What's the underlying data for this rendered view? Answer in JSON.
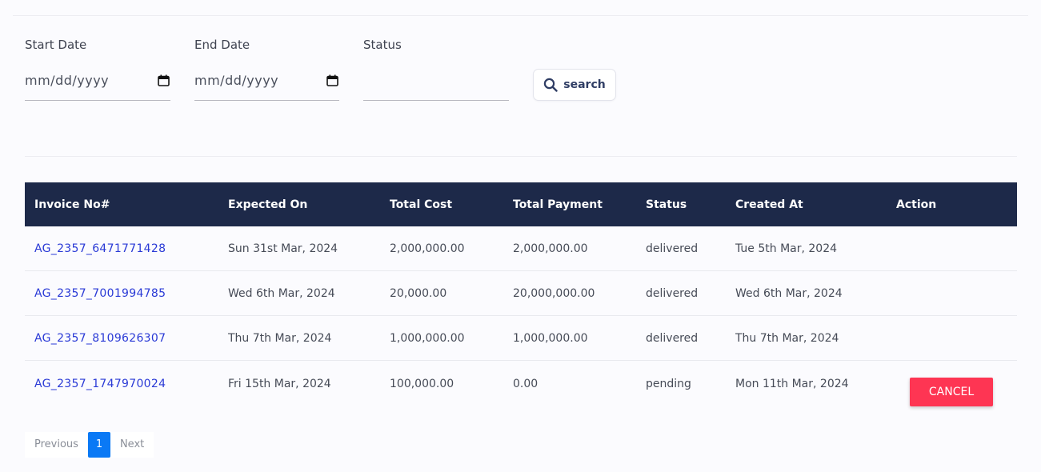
{
  "filters": {
    "start_date": {
      "label": "Start Date",
      "value": "mm/dd/yyyy"
    },
    "end_date": {
      "label": "End Date",
      "value": "mm/dd/yyyy"
    },
    "status": {
      "label": "Status",
      "value": ""
    },
    "search_button": {
      "label": "search",
      "icon": "search-icon"
    }
  },
  "table": {
    "headers": [
      "Invoice No#",
      "Expected On",
      "Total Cost",
      "Total Payment",
      "Status",
      "Created At",
      "Action"
    ],
    "rows": [
      {
        "invoice": "AG_2357_6471771428",
        "expected_on": "Sun 31st Mar, 2024",
        "total_cost": "2,000,000.00",
        "total_payment": "2,000,000.00",
        "status": "delivered",
        "created_at": "Tue 5th Mar, 2024",
        "action": ""
      },
      {
        "invoice": "AG_2357_7001994785",
        "expected_on": "Wed 6th Mar, 2024",
        "total_cost": "20,000.00",
        "total_payment": "20,000,000.00",
        "status": "delivered",
        "created_at": "Wed 6th Mar, 2024",
        "action": ""
      },
      {
        "invoice": "AG_2357_8109626307",
        "expected_on": "Thu 7th Mar, 2024",
        "total_cost": "1,000,000.00",
        "total_payment": "1,000,000.00",
        "status": "delivered",
        "created_at": "Thu 7th Mar, 2024",
        "action": ""
      },
      {
        "invoice": "AG_2357_1747970024",
        "expected_on": "Fri 15th Mar, 2024",
        "total_cost": "100,000.00",
        "total_payment": "0.00",
        "status": "pending",
        "created_at": "Mon 11th Mar, 2024",
        "action": "CANCEL"
      }
    ]
  },
  "pagination": {
    "previous": "Previous",
    "current": "1",
    "next": "Next"
  },
  "colors": {
    "header_bg": "#1d2949",
    "link": "#2a3ad6",
    "cancel": "#fe3553",
    "page_active": "#0a79f5"
  }
}
